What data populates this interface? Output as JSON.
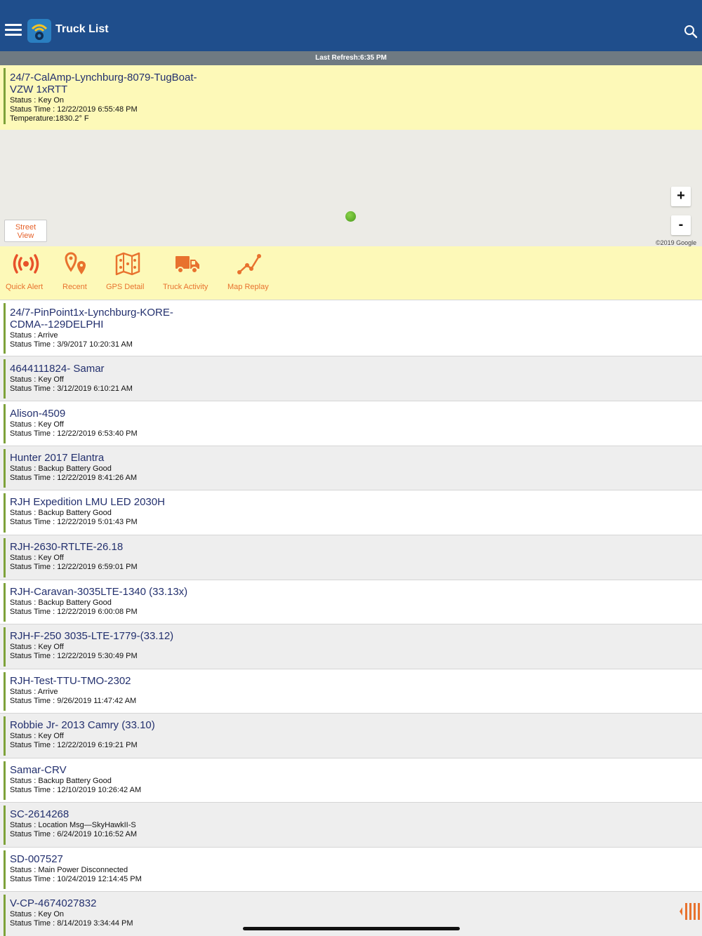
{
  "header": {
    "title": "Truck List",
    "menu_icon": "hamburger-icon",
    "search_icon": "search-icon"
  },
  "refresh": {
    "text": "Last Refresh:6:35 PM"
  },
  "selected": {
    "name_line1": "24/7-CalAmp-Lynchburg-8079-TugBoat-",
    "name_line2": "VZW 1xRTT",
    "status": "Status : Key On",
    "status_time": "Status Time : 12/22/2019 6:55:48 PM",
    "temperature": "Temperature:1830.2° F"
  },
  "map": {
    "street_view_line1": "Street",
    "street_view_line2": "View",
    "zoom_in": "+",
    "zoom_out": "-",
    "copyright": "©2019 Google"
  },
  "actions": [
    {
      "label": "Quick Alert",
      "icon": "quick-alert-icon"
    },
    {
      "label": "Recent",
      "icon": "recent-pins-icon"
    },
    {
      "label": "GPS Detail",
      "icon": "gps-map-icon"
    },
    {
      "label": "Truck Activity",
      "icon": "truck-icon"
    },
    {
      "label": "Map Replay",
      "icon": "map-replay-icon"
    }
  ],
  "trucks": [
    {
      "name_line1": "24/7-PinPoint1x-Lynchburg-KORE-",
      "name_line2": "CDMA--129DELPHI",
      "status": "Status : Arrive",
      "status_time": "Status Time : 3/9/2017 10:20:31 AM"
    },
    {
      "name": "4644111824- Samar",
      "status": "Status : Key Off",
      "status_time": "Status Time : 3/12/2019 6:10:21 AM"
    },
    {
      "name": "Alison-4509",
      "status": "Status : Key Off",
      "status_time": "Status Time : 12/22/2019 6:53:40 PM"
    },
    {
      "name": "Hunter 2017 Elantra",
      "status": "Status : Backup Battery Good",
      "status_time": "Status Time : 12/22/2019 8:41:26 AM"
    },
    {
      "name": "RJH Expedition LMU LED 2030H",
      "status": "Status : Backup Battery Good",
      "status_time": "Status Time : 12/22/2019 5:01:43 PM"
    },
    {
      "name": "RJH-2630-RTLTE-26.18",
      "status": "Status : Key Off",
      "status_time": "Status Time : 12/22/2019 6:59:01 PM"
    },
    {
      "name": "RJH-Caravan-3035LTE-1340 (33.13x)",
      "status": "Status : Backup Battery Good",
      "status_time": "Status Time : 12/22/2019 6:00:08 PM"
    },
    {
      "name": "RJH-F-250 3035-LTE-1779-(33.12)",
      "status": "Status : Key Off",
      "status_time": "Status Time : 12/22/2019 5:30:49 PM"
    },
    {
      "name": "RJH-Test-TTU-TMO-2302",
      "status": "Status : Arrive",
      "status_time": "Status Time : 9/26/2019 11:47:42 AM"
    },
    {
      "name": "Robbie Jr- 2013 Camry (33.10)",
      "status": "Status : Key Off",
      "status_time": "Status Time : 12/22/2019 6:19:21 PM"
    },
    {
      "name": "Samar-CRV",
      "status": "Status : Backup Battery Good",
      "status_time": "Status Time : 12/10/2019 10:26:42 AM"
    },
    {
      "name": "SC-2614268",
      "status": "Status : Location Msg—SkyHawkII-S",
      "status_time": "Status Time : 6/24/2019 10:16:52 AM"
    },
    {
      "name": "SD-007527",
      "status": "Status : Main Power Disconnected",
      "status_time": "Status Time : 10/24/2019 12:14:45 PM"
    },
    {
      "name": "V-CP-4674027832",
      "status": "Status : Key On",
      "status_time": "Status Time : 8/14/2019 3:34:44 PM"
    }
  ],
  "colors": {
    "header": "#1f4e8c",
    "highlight": "#fdf9b8",
    "accent": "#e8722e",
    "title_text": "#23306e",
    "status_bar": "#7ea23a"
  }
}
